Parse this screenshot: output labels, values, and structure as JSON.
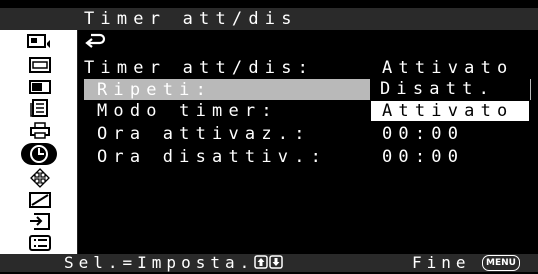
{
  "header": {
    "title": "Timer att/dis"
  },
  "menu": {
    "main_row": {
      "label": "Timer att/dis:",
      "value": "Attivato"
    },
    "rows": [
      {
        "label": "Ripeti:",
        "value": "Disatt."
      },
      {
        "label": "Modo timer:",
        "value": "Attivato"
      },
      {
        "label": "Ora attivaz.:",
        "value": "00:00"
      },
      {
        "label": "Ora disattiv.:",
        "value": "00:00"
      }
    ]
  },
  "dropdown": {
    "selected": "Disatt.",
    "option": "Attivato"
  },
  "footer": {
    "select_text": "Sel.=Imposta.",
    "end_text": "Fine",
    "menu_key": "MENU"
  },
  "sidebar": {
    "icons": [
      "picture-sound-icon",
      "screen-icon",
      "display-mode-icon",
      "document-icon",
      "printer-icon",
      "timer-icon",
      "input-arrows-icon",
      "adjust-icon",
      "input-select-icon",
      "list-icon"
    ],
    "active": "timer-icon"
  },
  "colors": {
    "highlight": "#b9b9b9",
    "bar": "#2a2a2a",
    "sidebar": "#ffffff"
  }
}
